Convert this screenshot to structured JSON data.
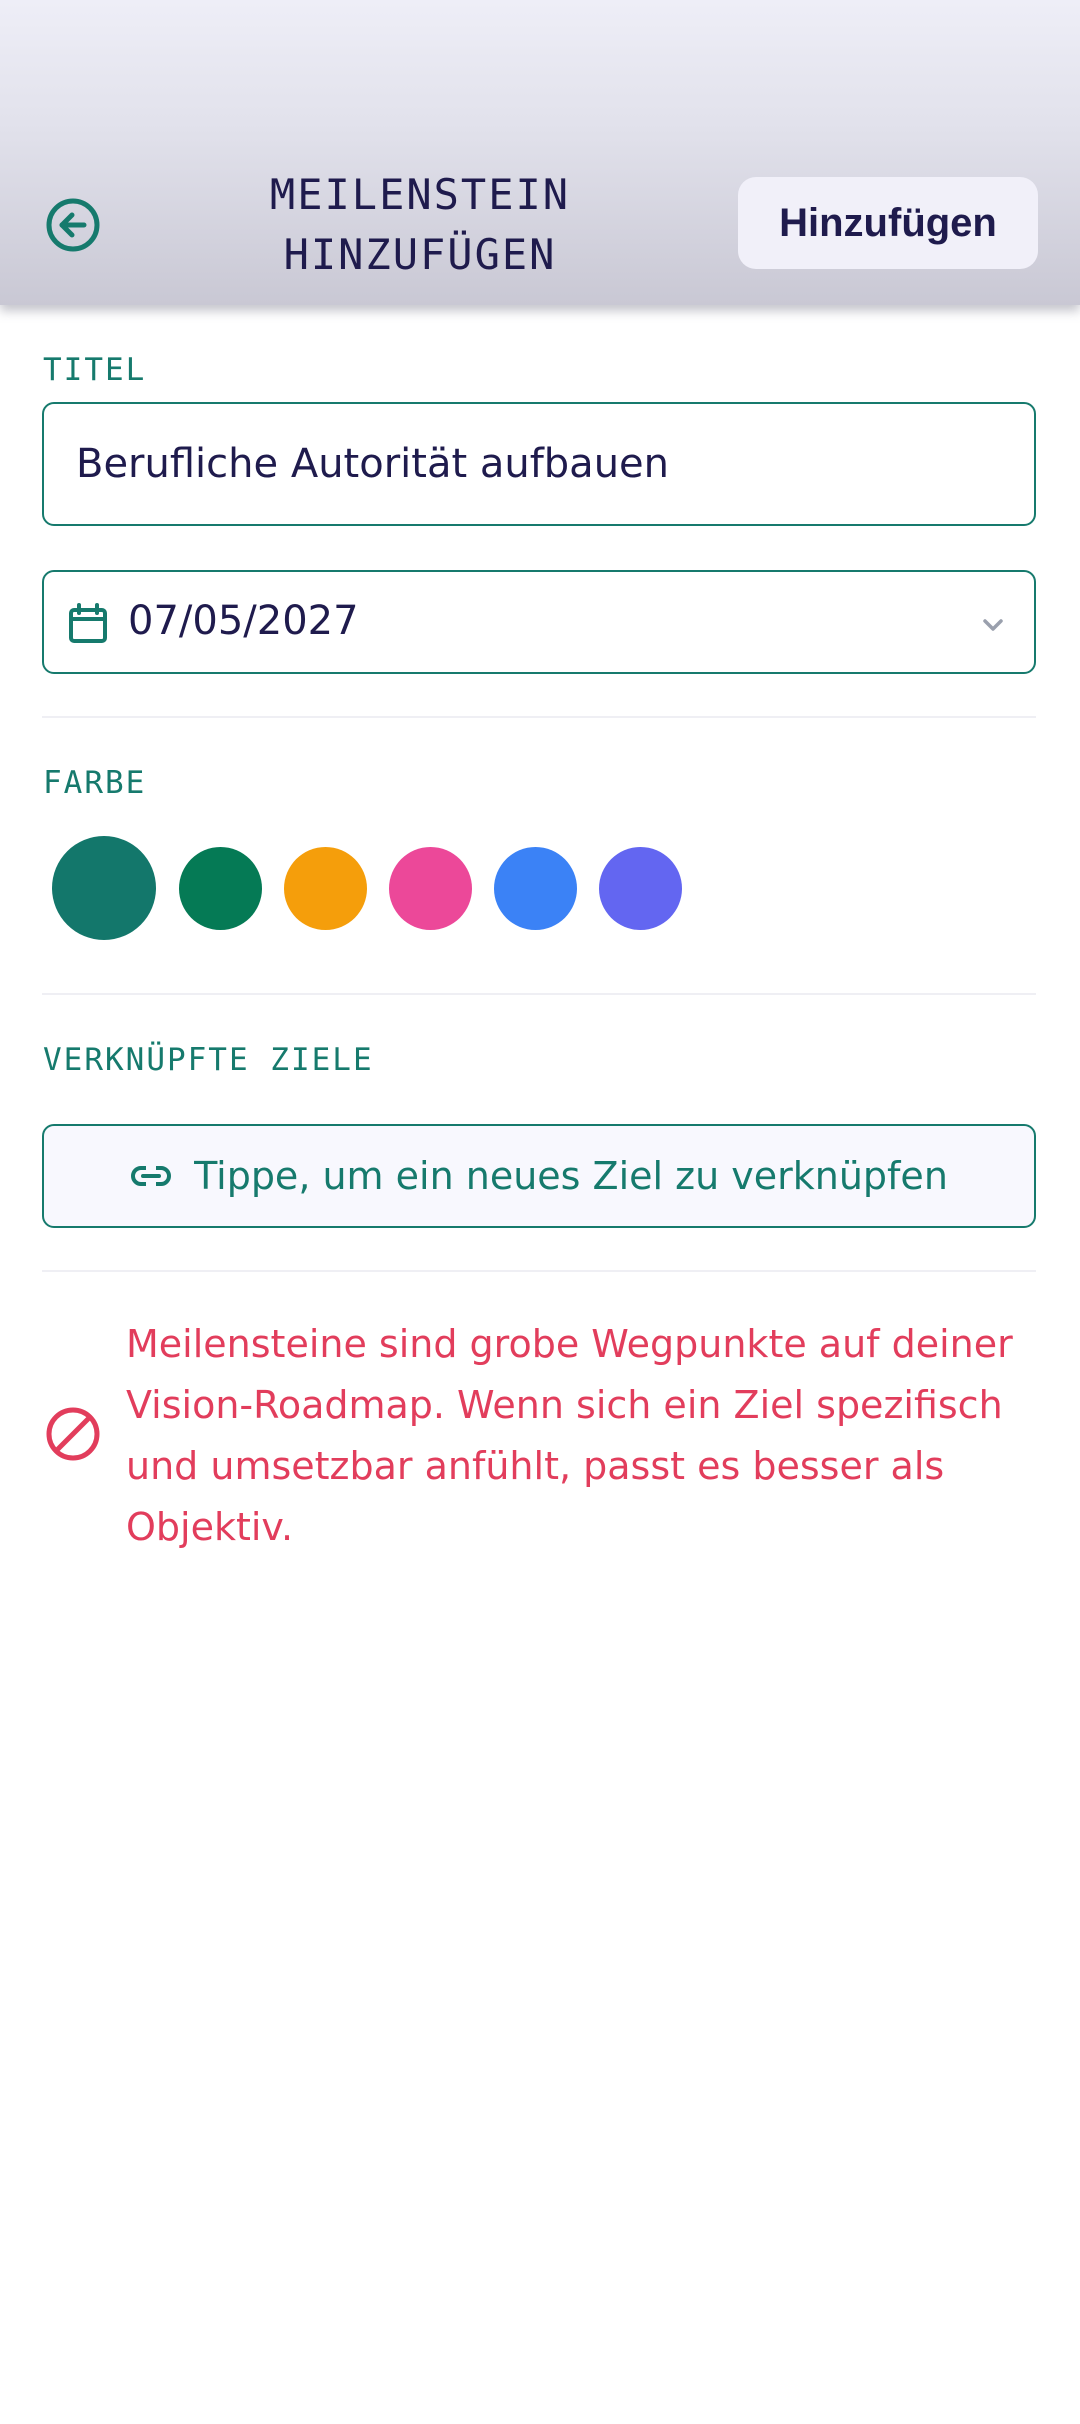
{
  "header": {
    "title_line1": "MEILENSTEIN",
    "title_line2": "HINZUFÜGEN",
    "add_label": "Hinzufügen",
    "back_icon": "arrow-left-circle-icon"
  },
  "form": {
    "title_label": "TITEL",
    "title_value": "Berufliche Autorität aufbauen",
    "date_value": "07/05/2027",
    "date_icon": "calendar-icon",
    "color_label": "FARBE",
    "colors": [
      "#13776b",
      "#057a55",
      "#f59e0b",
      "#ec4899",
      "#3b82f6",
      "#6366f1"
    ],
    "selected_color": "#13776b",
    "linked_label": "VERKNÜPFTE ZIELE",
    "link_button_label": "Tippe, um ein neues Ziel zu verknüpfen",
    "link_icon": "link-icon"
  },
  "info": {
    "icon": "prohibited-icon",
    "text": "Meilensteine sind grobe Wegpunkte auf deiner Vision-Roadmap. Wenn sich ein Ziel spezifisch und umsetzbar anfühlt, passt es besser als Objektiv."
  },
  "theme": {
    "accent": "#167a6d",
    "text_dark": "#1f1b4d",
    "warning": "#e23d5c"
  }
}
